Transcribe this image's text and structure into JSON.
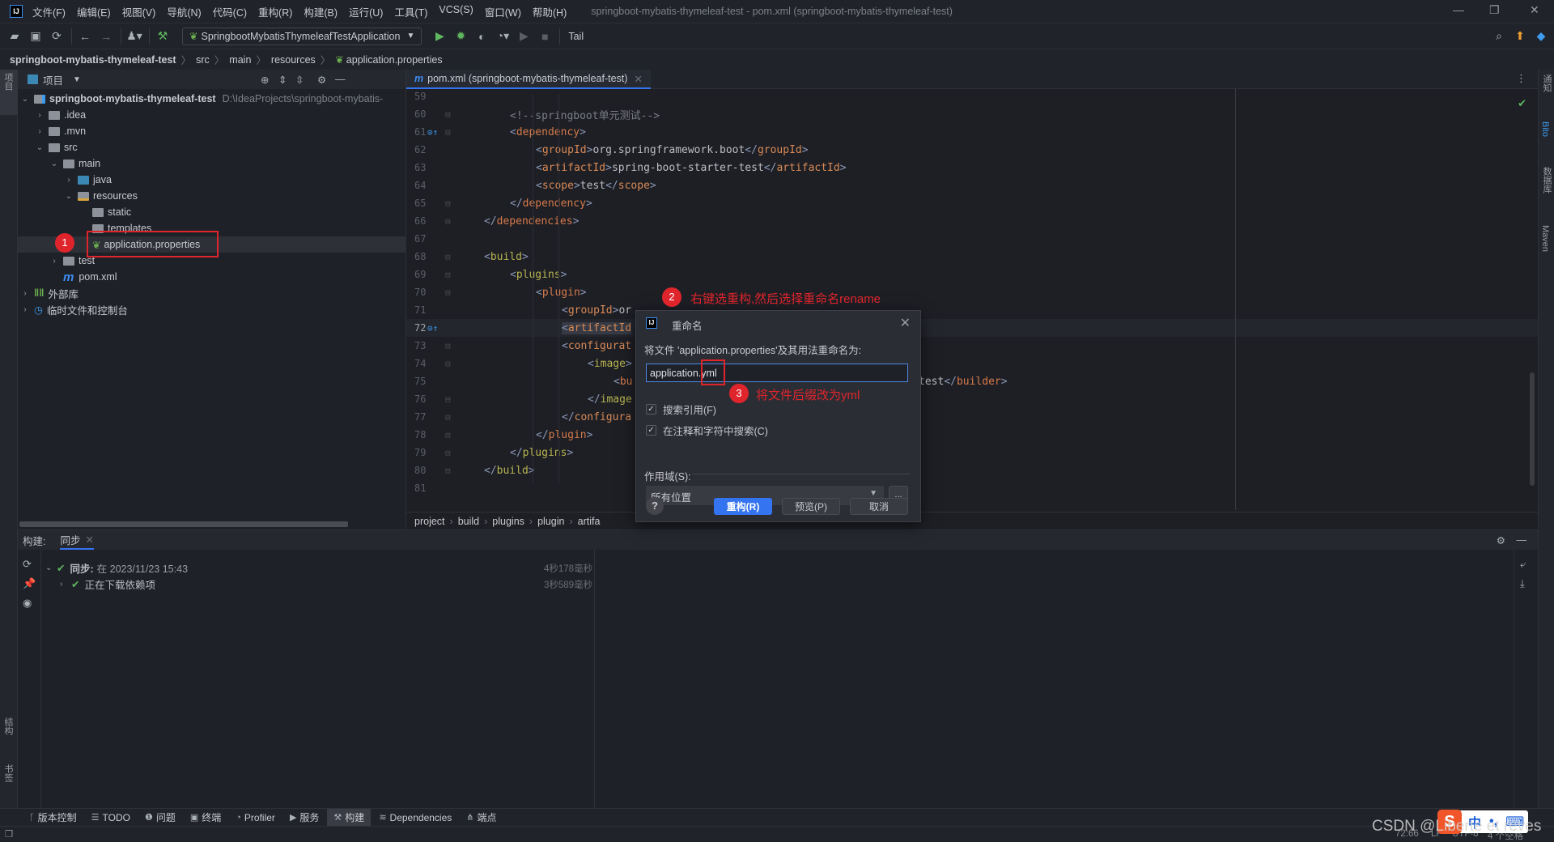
{
  "app": {
    "window_title": "springboot-mybatis-thymeleaf-test - pom.xml (springboot-mybatis-thymeleaf-test)",
    "logo": "IJ"
  },
  "menu": [
    "文件(F)",
    "编辑(E)",
    "视图(V)",
    "导航(N)",
    "代码(C)",
    "重构(R)",
    "构建(B)",
    "运行(U)",
    "工具(T)",
    "VCS(S)",
    "窗口(W)",
    "帮助(H)"
  ],
  "toolbar": {
    "run_config": "SpringbootMybatisThymeleafTestApplication",
    "tail": "Tail"
  },
  "breadcrumb": [
    "springboot-mybatis-thymeleaf-test",
    "src",
    "main",
    "resources",
    "application.properties"
  ],
  "left_strip": {
    "top": "项目",
    "structure": "结构",
    "bookmarks": "书签"
  },
  "right_strip": [
    "通知",
    "Bito",
    "数据库",
    "Maven"
  ],
  "project": {
    "title": "项目",
    "tree": [
      {
        "label": "springboot-mybatis-thymeleaf-test",
        "hint": "D:\\IdeaProjects\\springboot-mybatis-",
        "depth": 0,
        "arrow": "down",
        "icon": "module",
        "bold": true
      },
      {
        "label": ".idea",
        "depth": 1,
        "arrow": "right",
        "icon": "folder"
      },
      {
        "label": ".mvn",
        "depth": 1,
        "arrow": "right",
        "icon": "folder"
      },
      {
        "label": "src",
        "depth": 1,
        "arrow": "down",
        "icon": "folder"
      },
      {
        "label": "main",
        "depth": 2,
        "arrow": "down",
        "icon": "folder"
      },
      {
        "label": "java",
        "depth": 3,
        "arrow": "right",
        "icon": "folder-blue"
      },
      {
        "label": "resources",
        "depth": 3,
        "arrow": "down",
        "icon": "folder-resources"
      },
      {
        "label": "static",
        "depth": 4,
        "arrow": "",
        "icon": "folder"
      },
      {
        "label": "templates",
        "depth": 4,
        "arrow": "",
        "icon": "folder"
      },
      {
        "label": "application.properties",
        "depth": 4,
        "arrow": "",
        "icon": "spring-properties",
        "selected": true
      },
      {
        "label": "test",
        "depth": 2,
        "arrow": "right",
        "icon": "folder"
      },
      {
        "label": "pom.xml",
        "depth": 2,
        "arrow": "",
        "icon": "maven"
      },
      {
        "label": "外部库",
        "depth": 0,
        "arrow": "right",
        "icon": "library"
      },
      {
        "label": "临时文件和控制台",
        "depth": 0,
        "arrow": "right",
        "icon": "scratch"
      }
    ]
  },
  "editor": {
    "tab": "pom.xml (springboot-mybatis-thymeleaf-test)",
    "lines": [
      {
        "n": "59",
        "level": 0,
        "parts": []
      },
      {
        "n": "60",
        "level": 2,
        "parts": [
          {
            "t": "<!--springboot单元测试-->",
            "c": "cm"
          }
        ]
      },
      {
        "n": "61",
        "level": 2,
        "parts": [
          {
            "t": "<",
            "c": "br"
          },
          {
            "t": "dependency",
            "c": "tg l2"
          },
          {
            "t": ">",
            "c": "br"
          }
        ]
      },
      {
        "n": "62",
        "level": 3,
        "parts": [
          {
            "t": "<",
            "c": "br"
          },
          {
            "t": "groupId",
            "c": "tg l3"
          },
          {
            "t": ">",
            "c": "br"
          },
          {
            "t": "org.springframework.boot",
            "c": "tx"
          },
          {
            "t": "</",
            "c": "br"
          },
          {
            "t": "groupId",
            "c": "tg l3"
          },
          {
            "t": ">",
            "c": "br"
          }
        ]
      },
      {
        "n": "63",
        "level": 3,
        "parts": [
          {
            "t": "<",
            "c": "br"
          },
          {
            "t": "artifactId",
            "c": "tg l3"
          },
          {
            "t": ">",
            "c": "br"
          },
          {
            "t": "spring-boot-starter-test",
            "c": "tx"
          },
          {
            "t": "</",
            "c": "br"
          },
          {
            "t": "artifactId",
            "c": "tg l3"
          },
          {
            "t": ">",
            "c": "br"
          }
        ]
      },
      {
        "n": "64",
        "level": 3,
        "parts": [
          {
            "t": "<",
            "c": "br"
          },
          {
            "t": "scope",
            "c": "tg l3"
          },
          {
            "t": ">",
            "c": "br"
          },
          {
            "t": "test",
            "c": "tx"
          },
          {
            "t": "</",
            "c": "br"
          },
          {
            "t": "scope",
            "c": "tg l3"
          },
          {
            "t": ">",
            "c": "br"
          }
        ]
      },
      {
        "n": "65",
        "level": 2,
        "parts": [
          {
            "t": "</",
            "c": "br"
          },
          {
            "t": "dependency",
            "c": "tg l2"
          },
          {
            "t": ">",
            "c": "br"
          }
        ]
      },
      {
        "n": "66",
        "level": 1,
        "parts": [
          {
            "t": "</",
            "c": "br"
          },
          {
            "t": "dependencies",
            "c": "tg l2"
          },
          {
            "t": ">",
            "c": "br"
          }
        ]
      },
      {
        "n": "67",
        "level": 0,
        "parts": []
      },
      {
        "n": "68",
        "level": 1,
        "parts": [
          {
            "t": "<",
            "c": "br"
          },
          {
            "t": "build",
            "c": "tg l1"
          },
          {
            "t": ">",
            "c": "br"
          }
        ]
      },
      {
        "n": "69",
        "level": 2,
        "parts": [
          {
            "t": "<",
            "c": "br"
          },
          {
            "t": "plugins",
            "c": "tg l1"
          },
          {
            "t": ">",
            "c": "br"
          }
        ]
      },
      {
        "n": "70",
        "level": 3,
        "parts": [
          {
            "t": "<",
            "c": "br"
          },
          {
            "t": "plugin",
            "c": "tg l2"
          },
          {
            "t": ">",
            "c": "br"
          }
        ]
      },
      {
        "n": "71",
        "level": 4,
        "parts": [
          {
            "t": "<",
            "c": "br"
          },
          {
            "t": "groupId",
            "c": "tg l3"
          },
          {
            "t": ">",
            "c": "br"
          },
          {
            "t": "or",
            "c": "tx"
          }
        ]
      },
      {
        "n": "72",
        "level": 4,
        "current": true,
        "parts": [
          {
            "t": "<",
            "c": "br"
          },
          {
            "t": "artifactId",
            "c": "tg l3"
          }
        ]
      },
      {
        "n": "73",
        "level": 4,
        "parts": [
          {
            "t": "<",
            "c": "br"
          },
          {
            "t": "configurat",
            "c": "tg l3"
          }
        ]
      },
      {
        "n": "74",
        "level": 5,
        "parts": [
          {
            "t": "<",
            "c": "br"
          },
          {
            "t": "image",
            "c": "tg l1"
          },
          {
            "t": ">",
            "c": "br"
          }
        ]
      },
      {
        "n": "75",
        "level": 6,
        "parts": [
          {
            "t": "<",
            "c": "br"
          },
          {
            "t": "bu",
            "c": "tg l2"
          }
        ],
        "tail": [
          {
            "t": "test",
            "c": "tx"
          },
          {
            "t": "</",
            "c": "br"
          },
          {
            "t": "builder",
            "c": "tg l2"
          },
          {
            "t": ">",
            "c": "br"
          }
        ]
      },
      {
        "n": "76",
        "level": 5,
        "parts": [
          {
            "t": "</",
            "c": "br"
          },
          {
            "t": "image",
            "c": "tg l1"
          }
        ]
      },
      {
        "n": "77",
        "level": 4,
        "parts": [
          {
            "t": "</",
            "c": "br"
          },
          {
            "t": "configura",
            "c": "tg l3"
          }
        ]
      },
      {
        "n": "78",
        "level": 3,
        "parts": [
          {
            "t": "</",
            "c": "br"
          },
          {
            "t": "plugin",
            "c": "tg l2"
          },
          {
            "t": ">",
            "c": "br"
          }
        ]
      },
      {
        "n": "79",
        "level": 2,
        "parts": [
          {
            "t": "</",
            "c": "br"
          },
          {
            "t": "plugins",
            "c": "tg l1"
          },
          {
            "t": ">",
            "c": "br"
          }
        ]
      },
      {
        "n": "80",
        "level": 1,
        "parts": [
          {
            "t": "</",
            "c": "br"
          },
          {
            "t": "build",
            "c": "tg l1"
          },
          {
            "t": ">",
            "c": "br"
          }
        ]
      },
      {
        "n": "81",
        "level": 0,
        "parts": []
      }
    ],
    "crumbs": [
      "project",
      "build",
      "plugins",
      "plugin",
      "artifa"
    ]
  },
  "build": {
    "label": "构建:",
    "tab": "同步",
    "rows": [
      {
        "title": "同步:",
        "text": "在 2023/11/23 15:43",
        "duration": "4秒178毫秒"
      },
      {
        "title": "",
        "text": "正在下载依赖项",
        "duration": "3秒589毫秒"
      }
    ]
  },
  "bottom_tools": [
    {
      "icon": "branch",
      "label": "版本控制"
    },
    {
      "icon": "list",
      "label": "TODO"
    },
    {
      "icon": "problem",
      "label": "问题"
    },
    {
      "icon": "terminal",
      "label": "终端"
    },
    {
      "icon": "profiler",
      "label": "Profiler"
    },
    {
      "icon": "services",
      "label": "服务"
    },
    {
      "icon": "hammer",
      "label": "构建",
      "active": true
    },
    {
      "icon": "layers",
      "label": "Dependencies"
    },
    {
      "icon": "endpoints",
      "label": "端点"
    }
  ],
  "status": {
    "position": "72:66",
    "line_sep": "LF",
    "encoding": "UTF-8",
    "indent": "4 个空格"
  },
  "dialog": {
    "title": "重命名",
    "label": "将文件 'application.properties'及其用法重命名为:",
    "value": "application.yml",
    "search_refs": "搜索引用(F)",
    "search_comments": "在注释和字符中搜索(C)",
    "search_refs_checked": true,
    "search_comments_checked": true,
    "scope_label": "作用域(S):",
    "scope_value": "所有位置",
    "more": "...",
    "help": "?",
    "refactor": "重构(R)",
    "preview": "预览(P)",
    "cancel": "取消"
  },
  "annotations": [
    {
      "num": "1",
      "text": ""
    },
    {
      "num": "2",
      "text": "右键选重构,然后选择重命名rename"
    },
    {
      "num": "3",
      "text": "将文件后缀改为yml"
    }
  ],
  "watermark": "CSDN @Liberte et reves",
  "ime": {
    "lang": "中",
    "punct": "•,"
  },
  "colors": {
    "accent": "#3574f0",
    "annotation": "#e0242c",
    "success": "#5fb85f"
  }
}
